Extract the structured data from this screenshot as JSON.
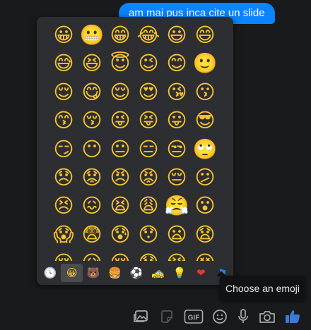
{
  "message": {
    "text": "am mai pus inca cite un slide"
  },
  "emoji_picker": {
    "emojis": [
      "😀",
      "😬",
      "😁",
      "😂",
      "😃",
      "😄",
      "😅",
      "😆",
      "😇",
      "😉",
      "😊",
      "🙂",
      "😌",
      "😋",
      "😌",
      "😍",
      "😘",
      "😗",
      "😙",
      "😚",
      "😜",
      "😝",
      "😛",
      "😎",
      "😏",
      "😶",
      "😐",
      "😑",
      "😒",
      "🙄",
      "😞",
      "😟",
      "😠",
      "😡",
      "😔",
      "😕",
      "😣",
      "😖",
      "😫",
      "😩",
      "😤",
      "😮",
      "😱",
      "😨",
      "😰",
      "😯",
      "😦",
      "😧",
      "😢",
      "😥",
      "😪",
      "😓",
      "😭",
      "😵"
    ],
    "tabs": [
      {
        "icon": "clock-icon",
        "glyph": "🕓"
      },
      {
        "icon": "smiley-icon",
        "glyph": "😀"
      },
      {
        "icon": "bear-icon",
        "glyph": "🐻"
      },
      {
        "icon": "burger-icon",
        "glyph": "🍔"
      },
      {
        "icon": "soccer-ball-icon",
        "glyph": "⚽"
      },
      {
        "icon": "car-icon",
        "glyph": "🚕"
      },
      {
        "icon": "lightbulb-icon",
        "glyph": "💡"
      },
      {
        "icon": "heart-icon",
        "glyph": "❤"
      },
      {
        "icon": "flag-icon",
        "glyph": "⚑"
      }
    ],
    "active_tab": 1
  },
  "tooltip": {
    "text": "Choose an emoji"
  },
  "toolbar": {
    "items": [
      "image-icon",
      "sticker-icon",
      "gif-icon",
      "emoji-icon",
      "microphone-icon",
      "camera-icon",
      "thumbs-up-icon"
    ],
    "gif_label": "GIF"
  },
  "colors": {
    "bubble": "#0b84ff",
    "picker_bg": "#2d2e31",
    "icon": "#a9abae",
    "like": "#3a7bd5"
  }
}
